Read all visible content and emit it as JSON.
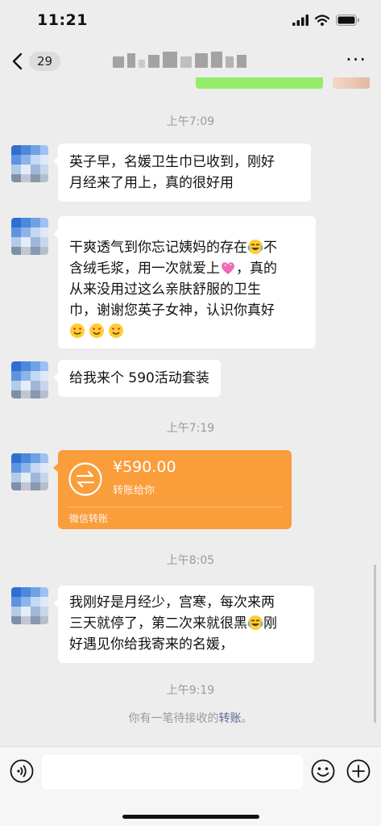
{
  "status": {
    "time": "11:21"
  },
  "nav": {
    "unread_count": "29",
    "more": "···"
  },
  "times": {
    "t1": "上午7:09",
    "t2": "上午7:19",
    "t3": "上午8:05",
    "t4": "上午9:19"
  },
  "messages": {
    "m1": {
      "line1": "英子早，名媛卫生巾已收到，刚好",
      "line2": "月经来了用上，真的很好用"
    },
    "m2": {
      "line1a": "干爽透气到你忘记姨妈的存在",
      "line1b": "不",
      "line2a": "含绒毛浆，用一次就爱上",
      "line2b": "，真的",
      "line3": "从来没用过这么亲肤舒服的卫生",
      "line4": "巾，谢谢您英子女神，认识你真好"
    },
    "m3": {
      "text": "给我来个 590活动套装"
    },
    "m4": {
      "line1": "我刚好是月经少，宫寒，每次来两",
      "line2a": "三天就停了，第二次来就很黑",
      "line2b": "刚",
      "line3": "好遇见你给我寄来的名媛，"
    }
  },
  "transfer": {
    "amount": "¥590.00",
    "desc": "转账给你",
    "footer": "微信转账"
  },
  "system": {
    "prefix": "你有一笔待接收的",
    "link": "转账",
    "suffix": "。"
  },
  "input": {
    "placeholder": ""
  },
  "icons": {
    "back": "chevron-left-icon",
    "more": "more-dots-icon",
    "transfer": "transfer-arrows-icon",
    "voice": "voice-icon",
    "emoji": "emoji-face-icon",
    "plus": "plus-circle-icon",
    "laugh_cry": "laugh-cry-emoji",
    "heart": "sparkling-heart-emoji",
    "heart_eyes": "heart-eyes-emoji"
  },
  "colors": {
    "background": "#ededed",
    "bubble": "#ffffff",
    "transfer": "#fa9d3b",
    "link": "#576b95",
    "sent": "#95ec69"
  }
}
